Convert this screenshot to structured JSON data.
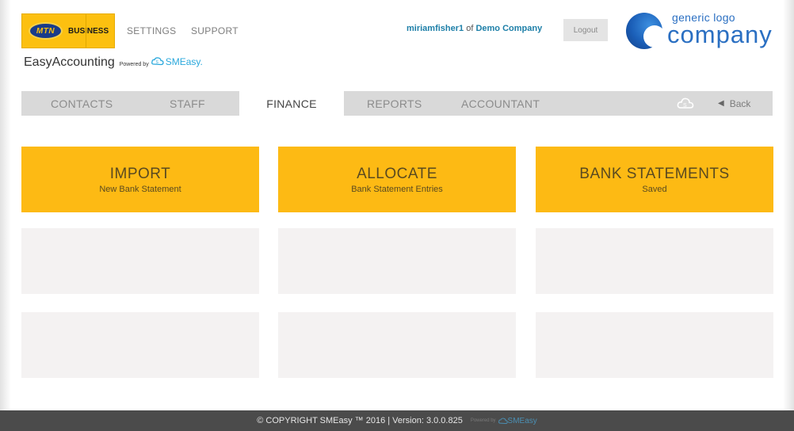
{
  "header": {
    "mtn_logo_text": "MTN",
    "business_text": "BUSINESS",
    "links": {
      "settings": "SETTINGS",
      "support": "SUPPORT"
    },
    "brand_name": "EasyAccounting",
    "powered_by": "Powered by",
    "smeasy": "SMEasy.",
    "username": "miriamfisher1",
    "of_text": "of",
    "company": "Demo Company",
    "logout_label": "Logout",
    "company_logo": {
      "small": "generic logo",
      "big": "company"
    }
  },
  "nav": {
    "items": [
      "CONTACTS",
      "STAFF",
      "FINANCE",
      "REPORTS",
      "ACCOUNTANT"
    ],
    "active": "FINANCE",
    "back_label": "Back"
  },
  "tiles": [
    {
      "title": "IMPORT",
      "subtitle": "New Bank Statement"
    },
    {
      "title": "ALLOCATE",
      "subtitle": "Bank Statement Entries"
    },
    {
      "title": "BANK STATEMENTS",
      "subtitle": "Saved"
    }
  ],
  "footer": {
    "copyright": "© COPYRIGHT SMEasy ™ 2016 | Version: 3.0.0.825",
    "powered_by": "Powered by",
    "smeasy": "SMEasy"
  },
  "colors": {
    "accent_yellow": "#fdba14",
    "mtn_yellow": "#fcc010",
    "link_blue": "#1d7fa8",
    "nav_gray": "#d9d9d9",
    "footer_bg": "#4b4b4b",
    "empty_tile": "#f4f2f2"
  },
  "icons": [
    "cloud-icon",
    "back-arrow-icon",
    "smeasy-logo-icon"
  ]
}
